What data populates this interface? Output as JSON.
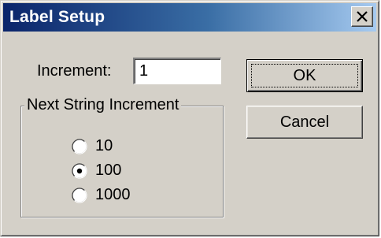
{
  "window": {
    "title": "Label Setup",
    "close_glyph": "×"
  },
  "form": {
    "increment_label": "Increment:",
    "increment_value": "1"
  },
  "buttons": {
    "ok_label": "OK",
    "cancel_label": "Cancel"
  },
  "group": {
    "legend": "Next String Increment",
    "options": [
      {
        "label": "10",
        "selected": false
      },
      {
        "label": "100",
        "selected": true
      },
      {
        "label": "1000",
        "selected": false
      }
    ]
  },
  "colors": {
    "face": "#d4d0c8",
    "title_start": "#0a246a",
    "title_end": "#a6caf0"
  }
}
